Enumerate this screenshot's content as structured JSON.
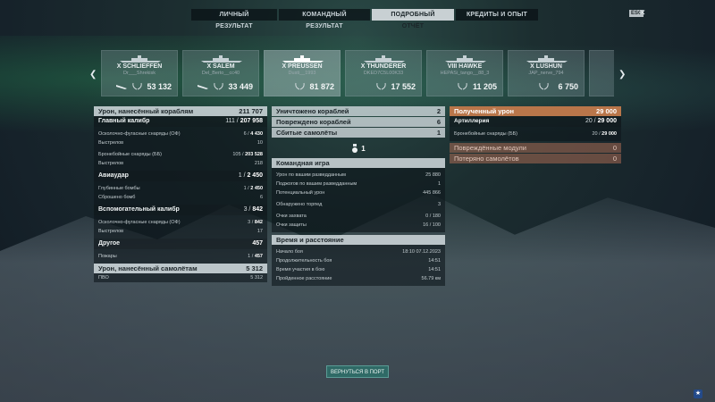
{
  "tabs": [
    {
      "label": "ЛИЧНЫЙ РЕЗУЛЬТАТ",
      "active": false
    },
    {
      "label": "КОМАНДНЫЙ РЕЗУЛЬТАТ",
      "active": false
    },
    {
      "label": "ПОДРОБНЫЙ ОТЧЁТ",
      "active": true
    },
    {
      "label": "КРЕДИТЫ И ОПЫТ",
      "active": false
    }
  ],
  "esc_label": "ESC",
  "close_label": "✕",
  "ships": [
    {
      "name": "X SCHLIEFFEN",
      "player": "Dr___Shrekisk",
      "stat": "53 132",
      "active": false
    },
    {
      "name": "X SALEM",
      "player": "Del_Berto__cc40",
      "stat": "33 449",
      "active": false
    },
    {
      "name": "X PREUSSEN",
      "player": "Dusti__1993",
      "stat": "81 872",
      "active": true
    },
    {
      "name": "X THUNDERER",
      "player": "DKED7C5L00K33",
      "stat": "17 552",
      "active": false
    },
    {
      "name": "VIII HAWKE",
      "player": "HEPASi_tango__88_3",
      "stat": "11 205",
      "active": false
    },
    {
      "name": "X LUSHUN",
      "player": "JAP_nerve_794",
      "stat": "6 750",
      "active": false
    }
  ],
  "col1": {
    "ship_damage": {
      "label": "Урон, нанесённый кораблям",
      "value": "211 707"
    },
    "main_caliber": {
      "label": "Главный калибр",
      "hits": "111",
      "value": "207 958",
      "he_label": "Осколочно-фугасные снаряды (ОФ)",
      "he_hits": "6",
      "he_value": "4 430",
      "he_shots_label": "Выстрелов",
      "he_shots": "10",
      "ap_label": "Бронебойные снаряды (ББ)",
      "ap_hits": "105",
      "ap_value": "203 528",
      "ap_shots_label": "Выстрелов",
      "ap_shots": "218"
    },
    "airstrike": {
      "label": "Авиаудар",
      "hits": "1",
      "value": "2 450",
      "depth_label": "Глубинные бомбы",
      "depth_hits": "1",
      "depth_value": "2 450",
      "dropped_label": "Сброшено бомб",
      "dropped": "6"
    },
    "secondary": {
      "label": "Вспомогательный калибр",
      "hits": "3",
      "value": "842",
      "he_label": "Осколочно-фугасные снаряды (ОФ)",
      "he_hits": "3",
      "he_value": "842",
      "shots_label": "Выстрелов",
      "shots": "17"
    },
    "other": {
      "label": "Другое",
      "value": "457",
      "fires_label": "Пожары",
      "fires_hits": "1",
      "fires_value": "457"
    },
    "plane_damage": {
      "label": "Урон, нанесённый самолётам",
      "value": "5 312",
      "aa_label": "ПВО",
      "aa_value": "5 312"
    }
  },
  "col2": {
    "destroyed": {
      "label": "Уничтожено кораблей",
      "value": "2"
    },
    "damaged": {
      "label": "Повреждено кораблей",
      "value": "6"
    },
    "planes": {
      "label": "Сбитые самолёты",
      "value": "1"
    },
    "medal_count": "1",
    "team": {
      "label": "Командная игра",
      "rows": [
        {
          "label": "Урон по вашим разведданным",
          "value": "25 880"
        },
        {
          "label": "Поджогов по вашим разведданным",
          "value": "1"
        },
        {
          "label": "Потенциальный урон",
          "value": "445 866"
        },
        {
          "label": "Обнаружено торпед",
          "value": "3"
        },
        {
          "label": "Очки захвата",
          "value": "0 / 180"
        },
        {
          "label": "Очки защиты",
          "value": "16 / 100"
        }
      ]
    },
    "time": {
      "label": "Время и расстояние",
      "rows": [
        {
          "label": "Начало боя",
          "value": "18:10  07.12.2023"
        },
        {
          "label": "Продолжительность боя",
          "value": "14:51"
        },
        {
          "label": "Время участия в бою",
          "value": "14:51"
        },
        {
          "label": "Пройденное расстояние",
          "value": "56.79 км"
        }
      ]
    }
  },
  "col3": {
    "received": {
      "label": "Полученный урон",
      "value": "29 000"
    },
    "artillery": {
      "label": "Артиллерия",
      "hits": "20",
      "value": "29 000"
    },
    "ap": {
      "label": "Бронебойные снаряды (ББ)",
      "hits": "20",
      "value": "29 000"
    },
    "modules": {
      "label": "Повреждённые модули",
      "value": "0"
    },
    "lost_planes": {
      "label": "Потеряно самолётов",
      "value": "0"
    }
  },
  "return_button": "ВЕРНУТЬСЯ В ПОРТ",
  "corner_icon": "★"
}
